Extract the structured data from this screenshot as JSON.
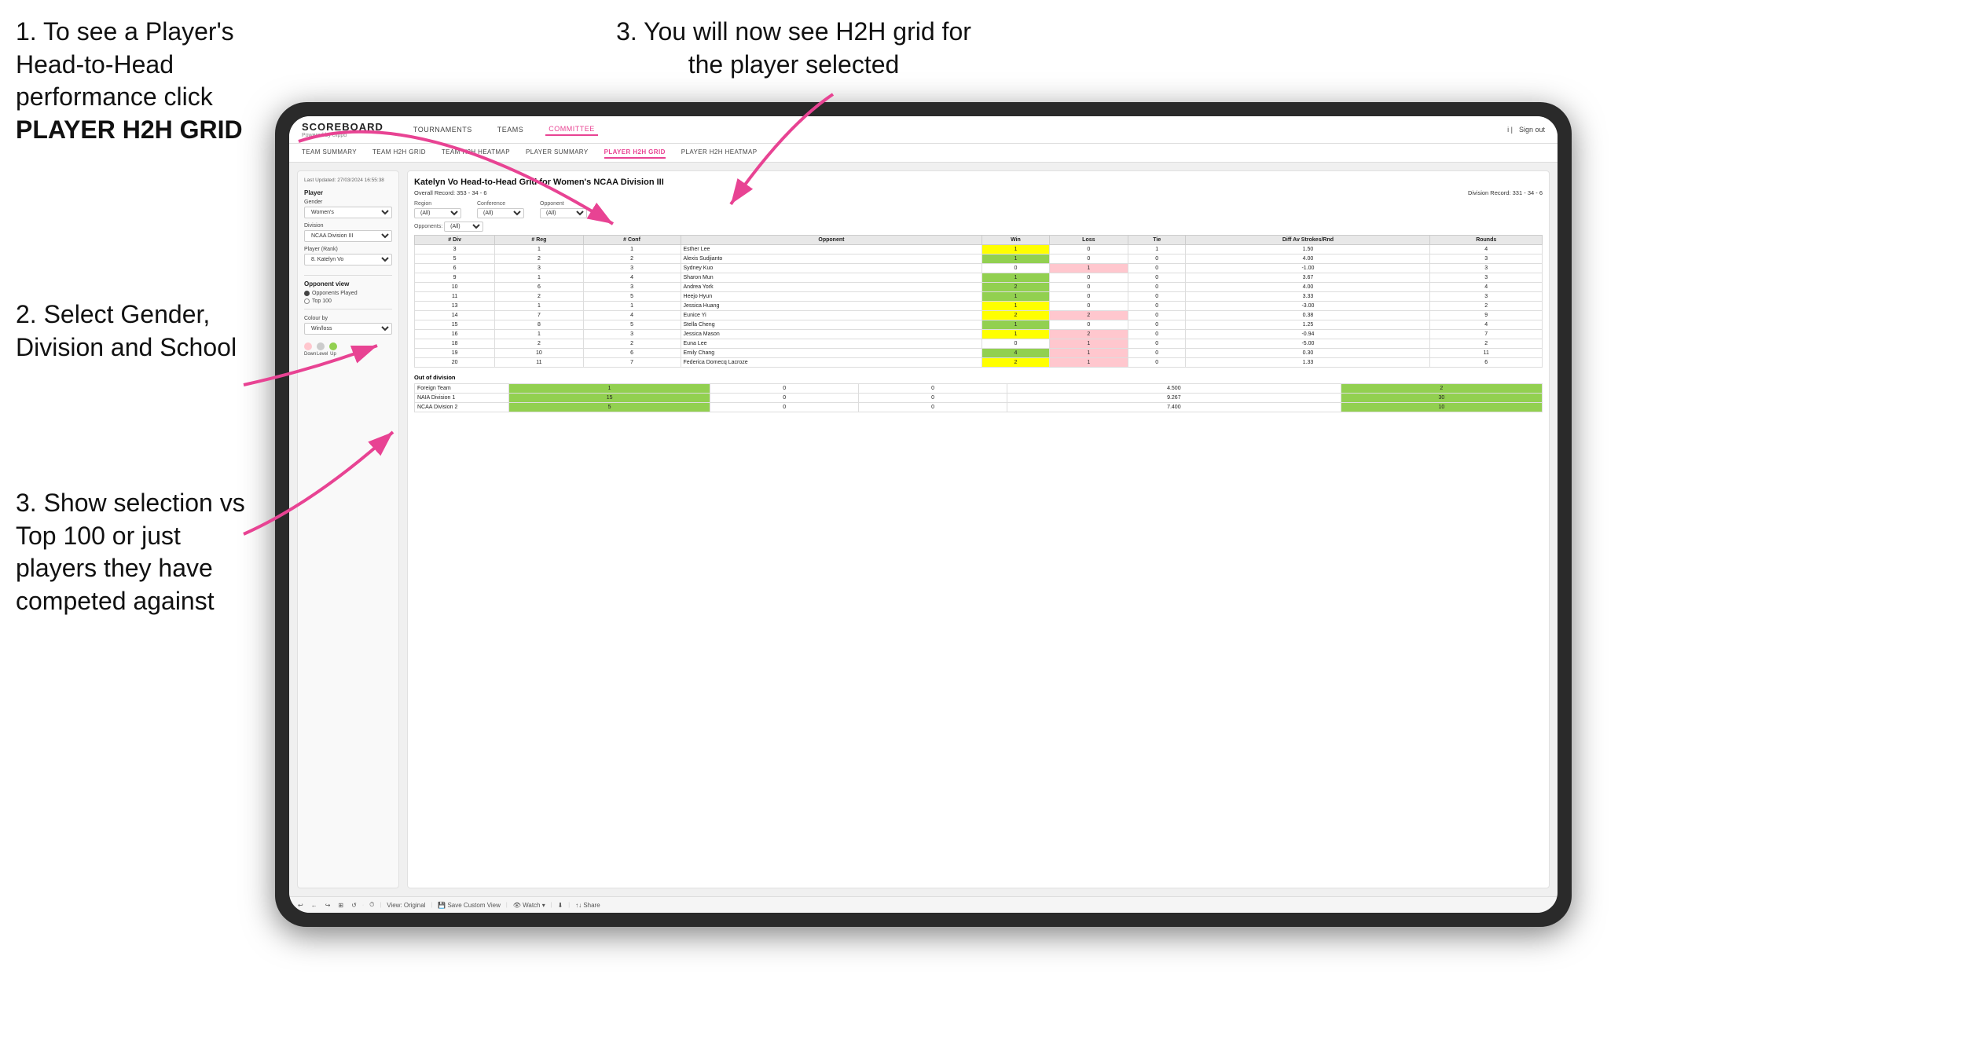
{
  "instructions": {
    "step1": {
      "text": "1. To see a Player's Head-to-Head performance click",
      "bold": "PLAYER H2H GRID"
    },
    "step2": {
      "text": "2. Select Gender, Division and School"
    },
    "step3_top": {
      "text": "3. You will now see H2H grid for the player selected"
    },
    "step3_bot": {
      "text": "3. Show selection vs Top 100 or just players they have competed against"
    }
  },
  "header": {
    "logo": "SCOREBOARD",
    "logo_sub": "Powered by clippd",
    "nav": [
      "TOURNAMENTS",
      "TEAMS",
      "COMMITTEE"
    ],
    "active_nav": "COMMITTEE",
    "sign_out": "Sign out"
  },
  "sub_nav": [
    "TEAM SUMMARY",
    "TEAM H2H GRID",
    "TEAM H2H HEATMAP",
    "PLAYER SUMMARY",
    "PLAYER H2H GRID",
    "PLAYER H2H HEATMAP"
  ],
  "active_sub_nav": "PLAYER H2H GRID",
  "sidebar": {
    "timestamp": "Last Updated: 27/03/2024 16:55:38",
    "player_label": "Player",
    "gender_label": "Gender",
    "gender_value": "Women's",
    "division_label": "Division",
    "division_value": "NCAA Division III",
    "player_rank_label": "Player (Rank)",
    "player_rank_value": "8. Katelyn Vo",
    "opponent_view_label": "Opponent view",
    "opponent_options": [
      "Opponents Played",
      "Top 100"
    ],
    "opponent_selected": "Opponents Played",
    "colour_by_label": "Colour by",
    "colour_by_value": "Win/loss",
    "colour_labels": [
      "Down",
      "Level",
      "Up"
    ]
  },
  "table": {
    "title": "Katelyn Vo Head-to-Head Grid for Women's NCAA Division III",
    "overall_record": "Overall Record: 353 - 34 - 6",
    "division_record": "Division Record: 331 - 34 - 6",
    "region_label": "Region",
    "conference_label": "Conference",
    "opponent_label": "Opponent",
    "opponents_label": "Opponents:",
    "region_value": "(All)",
    "conference_value": "(All)",
    "opponent_value": "(All)",
    "columns": [
      "# Div",
      "# Reg",
      "# Conf",
      "Opponent",
      "Win",
      "Loss",
      "Tie",
      "Diff Av Strokes/Rnd",
      "Rounds"
    ],
    "rows": [
      {
        "div": 3,
        "reg": 1,
        "conf": 1,
        "opponent": "Esther Lee",
        "win": 1,
        "loss": 0,
        "tie": 1,
        "diff": 1.5,
        "rounds": 4,
        "win_color": "yellow",
        "loss_color": "white",
        "tie_color": "white"
      },
      {
        "div": 5,
        "reg": 2,
        "conf": 2,
        "opponent": "Alexis Sudjianto",
        "win": 1,
        "loss": 0,
        "tie": 0,
        "diff": 4.0,
        "rounds": 3,
        "win_color": "green",
        "loss_color": "white",
        "tie_color": "white"
      },
      {
        "div": 6,
        "reg": 3,
        "conf": 3,
        "opponent": "Sydney Kuo",
        "win": 0,
        "loss": 1,
        "tie": 0,
        "diff": -1.0,
        "rounds": 3,
        "win_color": "white",
        "loss_color": "light-red",
        "tie_color": "white"
      },
      {
        "div": 9,
        "reg": 1,
        "conf": 4,
        "opponent": "Sharon Mun",
        "win": 1,
        "loss": 0,
        "tie": 0,
        "diff": 3.67,
        "rounds": 3,
        "win_color": "green",
        "loss_color": "white",
        "tie_color": "white"
      },
      {
        "div": 10,
        "reg": 6,
        "conf": 3,
        "opponent": "Andrea York",
        "win": 2,
        "loss": 0,
        "tie": 0,
        "diff": 4.0,
        "rounds": 4,
        "win_color": "green",
        "loss_color": "white",
        "tie_color": "white"
      },
      {
        "div": 11,
        "reg": 2,
        "conf": 5,
        "opponent": "Heejo Hyun",
        "win": 1,
        "loss": 0,
        "tie": 0,
        "diff": 3.33,
        "rounds": 3,
        "win_color": "green",
        "loss_color": "white",
        "tie_color": "white"
      },
      {
        "div": 13,
        "reg": 1,
        "conf": 1,
        "opponent": "Jessica Huang",
        "win": 1,
        "loss": 0,
        "tie": 0,
        "diff": -3.0,
        "rounds": 2,
        "win_color": "yellow",
        "loss_color": "white",
        "tie_color": "white"
      },
      {
        "div": 14,
        "reg": 7,
        "conf": 4,
        "opponent": "Eunice Yi",
        "win": 2,
        "loss": 2,
        "tie": 0,
        "diff": 0.38,
        "rounds": 9,
        "win_color": "yellow",
        "loss_color": "light-red",
        "tie_color": "white"
      },
      {
        "div": 15,
        "reg": 8,
        "conf": 5,
        "opponent": "Stella Cheng",
        "win": 1,
        "loss": 0,
        "tie": 0,
        "diff": 1.25,
        "rounds": 4,
        "win_color": "green",
        "loss_color": "white",
        "tie_color": "white"
      },
      {
        "div": 16,
        "reg": 1,
        "conf": 3,
        "opponent": "Jessica Mason",
        "win": 1,
        "loss": 2,
        "tie": 0,
        "diff": -0.94,
        "rounds": 7,
        "win_color": "yellow",
        "loss_color": "light-red",
        "tie_color": "white"
      },
      {
        "div": 18,
        "reg": 2,
        "conf": 2,
        "opponent": "Euna Lee",
        "win": 0,
        "loss": 1,
        "tie": 0,
        "diff": -5.0,
        "rounds": 2,
        "win_color": "white",
        "loss_color": "light-red",
        "tie_color": "white"
      },
      {
        "div": 19,
        "reg": 10,
        "conf": 6,
        "opponent": "Emily Chang",
        "win": 4,
        "loss": 1,
        "tie": 0,
        "diff": 0.3,
        "rounds": 11,
        "win_color": "green",
        "loss_color": "light-red",
        "tie_color": "white"
      },
      {
        "div": 20,
        "reg": 11,
        "conf": 7,
        "opponent": "Federica Domecq Lacroze",
        "win": 2,
        "loss": 1,
        "tie": 0,
        "diff": 1.33,
        "rounds": 6,
        "win_color": "yellow",
        "loss_color": "light-red",
        "tie_color": "white"
      }
    ],
    "out_of_division_label": "Out of division",
    "out_of_division_rows": [
      {
        "label": "Foreign Team",
        "win": 1,
        "loss": 0,
        "tie": 0,
        "diff": 4.5,
        "rounds": 2
      },
      {
        "label": "NAIA Division 1",
        "win": 15,
        "loss": 0,
        "tie": 0,
        "diff": 9.267,
        "rounds": 30
      },
      {
        "label": "NCAA Division 2",
        "win": 5,
        "loss": 0,
        "tie": 0,
        "diff": 7.4,
        "rounds": 10
      }
    ]
  },
  "toolbar": {
    "items": [
      "↩",
      "←",
      "↪",
      "⊞",
      "↺",
      "·",
      "⏱",
      "| View: Original",
      "Save Custom View",
      "👁 Watch ▾",
      "⬇",
      "↑↓",
      "< Share"
    ]
  },
  "colors": {
    "active_nav": "#e84393",
    "green": "#92d050",
    "yellow": "#ffff00",
    "light_red": "#ffc7ce",
    "light_green": "#c6efce",
    "orange": "#ffa500"
  }
}
